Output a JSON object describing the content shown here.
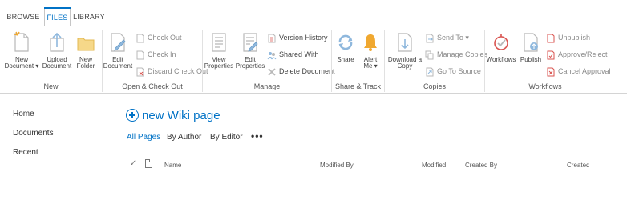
{
  "ribbon": {
    "tabs": [
      {
        "label": "BROWSE"
      },
      {
        "label": "FILES"
      },
      {
        "label": "LIBRARY"
      }
    ],
    "groups": {
      "new": {
        "label": "New",
        "new_document": "New\nDocument ▾",
        "upload_document": "Upload\nDocument",
        "new_folder": "New\nFolder"
      },
      "open": {
        "label": "Open & Check Out",
        "edit_document": "Edit\nDocument",
        "check_out": "Check Out",
        "check_in": "Check In",
        "discard_check_out": "Discard Check Out"
      },
      "manage": {
        "label": "Manage",
        "view_properties": "View\nProperties",
        "edit_properties": "Edit\nProperties",
        "version_history": "Version History",
        "shared_with": "Shared With",
        "delete_document": "Delete Document"
      },
      "share": {
        "label": "Share & Track",
        "share": "Share",
        "alert_me": "Alert\nMe ▾"
      },
      "copies": {
        "label": "Copies",
        "download_copy": "Download a\nCopy",
        "send_to": "Send To ▾",
        "manage_copies": "Manage Copies",
        "go_to_source": "Go To Source"
      },
      "workflows": {
        "label": "Workflows",
        "workflows": "Workflows",
        "publish": "Publish",
        "unpublish": "Unpublish",
        "approve_reject": "Approve/Reject",
        "cancel_approval": "Cancel Approval"
      }
    }
  },
  "leftnav": {
    "items": [
      {
        "label": "Home"
      },
      {
        "label": "Documents"
      },
      {
        "label": "Recent"
      }
    ]
  },
  "main": {
    "new_wiki_label": "new Wiki page",
    "views": [
      {
        "label": "All Pages"
      },
      {
        "label": "By Author"
      },
      {
        "label": "By Editor"
      }
    ],
    "more_label": "•••",
    "check_glyph": "✓",
    "columns": {
      "name": "Name",
      "modified_by": "Modified By",
      "modified": "Modified",
      "created_by": "Created By",
      "created": "Created"
    }
  },
  "colors": {
    "accent": "#0072c6",
    "icon_gray": "#b8b8b8",
    "icon_orange": "#f0a830",
    "icon_red": "#d9534f"
  }
}
